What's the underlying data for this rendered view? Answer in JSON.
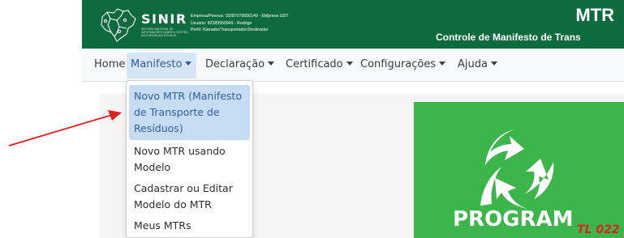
{
  "header": {
    "logo_name": "SINIR",
    "logo_subtitle": "SISTEMA NACIONAL DE INFORMAÇÕES SOBRE A GESTÃO DOS RESÍDUOS SÓLIDOS",
    "user_lines": [
      "Empresa/Pessoa: 18287079000149 - EMpresa GDT",
      "Usuário: 82389950949 - Rodrigo",
      "Perfil: /Gerador/Transportador/Destinador"
    ],
    "brand_title": "MTR",
    "brand_subtitle": "Controle de Manifesto de Trans",
    "bg_color": "#0e6b3e"
  },
  "navbar": {
    "items": [
      {
        "label": "Home",
        "dropdown": false
      },
      {
        "label": "Manifesto",
        "dropdown": true,
        "active": true
      },
      {
        "label": "Declaração",
        "dropdown": true
      },
      {
        "label": "Certificado",
        "dropdown": true
      },
      {
        "label": "Configurações",
        "dropdown": true
      },
      {
        "label": "Ajuda",
        "dropdown": true
      }
    ]
  },
  "dropdown": {
    "items": [
      {
        "label": "Novo MTR (Manifesto de Transporte de Resíduos)",
        "selected": true
      },
      {
        "label": "Novo MTR usando Modelo"
      },
      {
        "label": "Cadastrar ou Editar Modelo do MTR"
      },
      {
        "label": "Meus MTRs"
      }
    ]
  },
  "banner": {
    "title": "PROGRAM",
    "bg_color": "#3cb54a",
    "icon": "recycle-leaf-icon"
  },
  "annotation": {
    "label": "TL 022",
    "color": "#e02020"
  }
}
